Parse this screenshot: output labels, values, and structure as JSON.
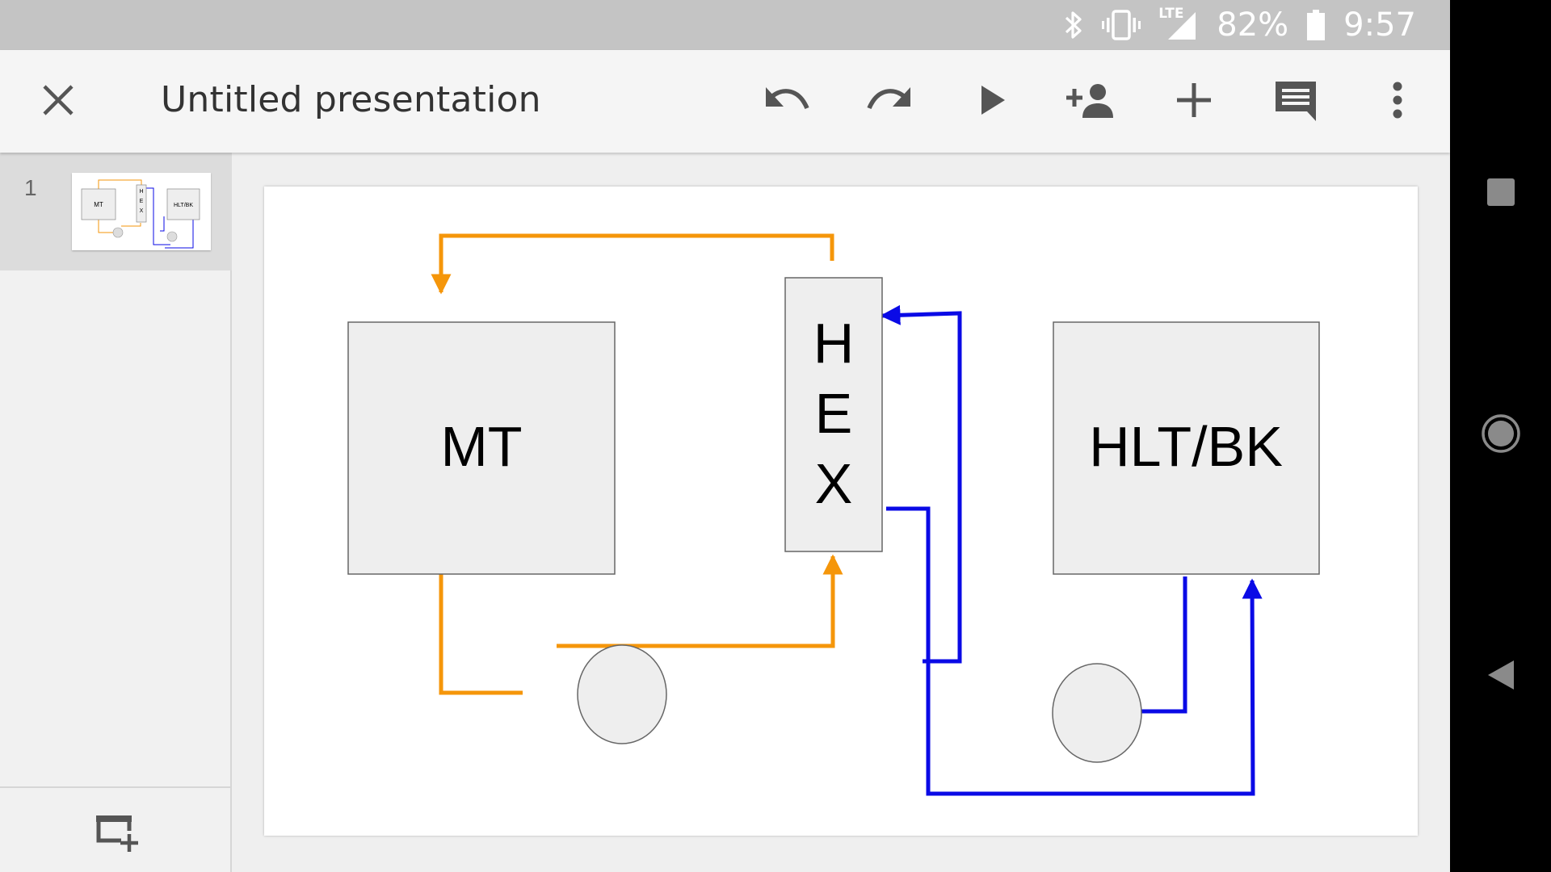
{
  "status_bar": {
    "network_label": "LTE",
    "battery_text": "82%",
    "time": "9:57",
    "icons": [
      "bluetooth-icon",
      "vibrate-icon",
      "signal-icon",
      "battery-icon"
    ]
  },
  "app_bar": {
    "title": "Untitled presentation",
    "icons": [
      "close-icon",
      "undo-icon",
      "redo-icon",
      "play-icon",
      "add-person-icon",
      "plus-icon",
      "comment-icon",
      "more-vert-icon"
    ]
  },
  "slide_panel": {
    "slides": [
      {
        "number": "1"
      }
    ],
    "new_slide_icon": "new-slide-icon"
  },
  "slide": {
    "boxes": {
      "mt": "MT",
      "hex_letters": [
        "H",
        "E",
        "X"
      ],
      "hlt": "HLT/BK"
    },
    "thumbnail": {
      "mt": "MT",
      "hex_letters": [
        "H",
        "E",
        "X"
      ],
      "hlt": "HLT/BK"
    },
    "colors": {
      "orange_line": "#f5960a",
      "blue_line": "#0a0ae6",
      "box_fill": "#eeeeee",
      "box_stroke": "#666666"
    }
  },
  "nav_bar": {
    "icons": [
      "recents-icon",
      "home-icon",
      "back-icon"
    ]
  }
}
